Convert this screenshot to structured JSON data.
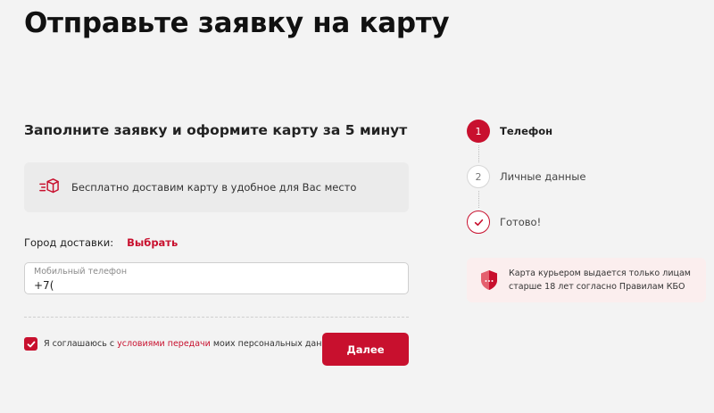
{
  "page": {
    "title": "Отправьте заявку на карту"
  },
  "form": {
    "subtitle": "Заполните заявку и оформите карту за 5 минут",
    "delivery_info": "Бесплатно доставим карту в удобное для Вас место",
    "city_label": "Город доставки:",
    "city_link": "Выбрать",
    "phone": {
      "placeholder": "Мобильный телефон",
      "value": "+7("
    },
    "consent": {
      "checked": true,
      "text_before": "Я соглашаюсь с",
      "link": "условиями передачи",
      "text_after": "моих персональных данных"
    },
    "submit_label": "Далее"
  },
  "steps": [
    {
      "number": "1",
      "label": "Телефон",
      "state": "active"
    },
    {
      "number": "2",
      "label": "Личные данные",
      "state": "pending"
    },
    {
      "number": "",
      "label": "Готово!",
      "state": "final"
    }
  ],
  "notice": {
    "line1": "Карта курьером выдается только лицам",
    "line2": "старше 18 лет согласно Правилам КБО"
  },
  "colors": {
    "accent": "#c8102e",
    "background": "#f3f3f3",
    "notice_bg": "#fbeeee"
  },
  "icons": {
    "delivery": "delivery-box-icon",
    "check": "checkmark-icon",
    "shield": "shield-icon"
  }
}
